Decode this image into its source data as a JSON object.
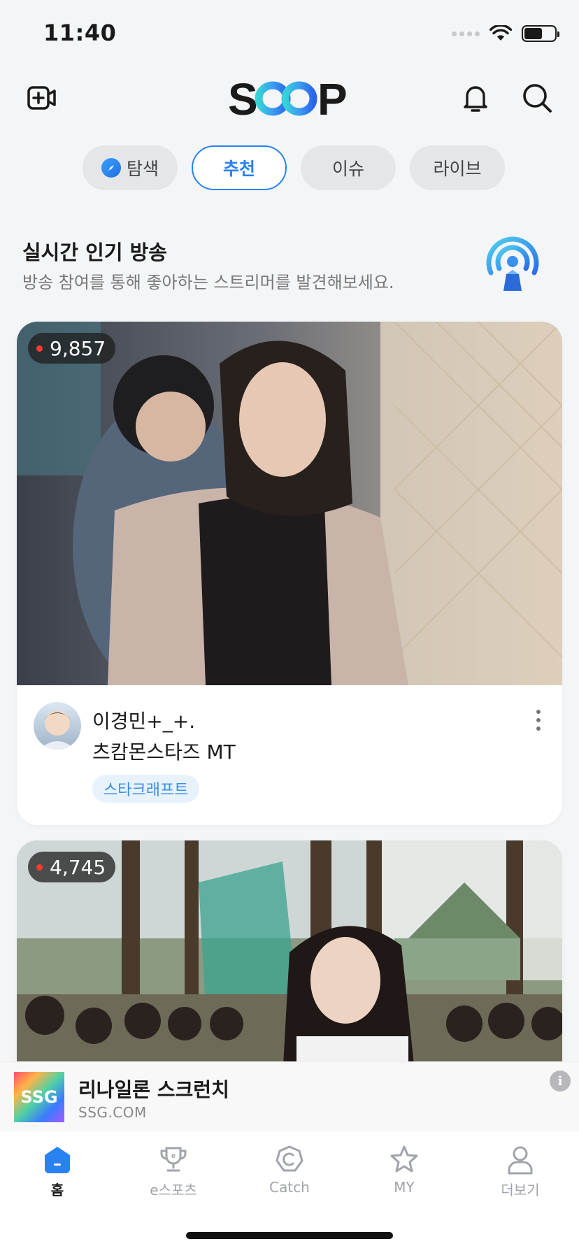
{
  "status_bar": {
    "time": "11:40",
    "battery_level": 0.6
  },
  "header": {
    "create_icon": "video-plus-icon",
    "logo_text": "SOOP",
    "bell_icon": "bell-icon",
    "search_icon": "search-icon"
  },
  "tabs": [
    {
      "label": "탐색",
      "icon": "compass-icon",
      "active": false
    },
    {
      "label": "추천",
      "active": true
    },
    {
      "label": "이슈",
      "active": false
    },
    {
      "label": "라이브",
      "active": false
    }
  ],
  "section": {
    "title": "실시간 인기 방송",
    "subtitle": "방송 참여를 통해 좋아하는 스트리머를 발견해보세요."
  },
  "streams": [
    {
      "viewers": "9,857",
      "streamer": "이경민+_+.",
      "title": "츠캄몬스타즈 MT",
      "category": "스타크래프트"
    },
    {
      "viewers": "4,745"
    }
  ],
  "ad": {
    "logo_text": "SSG",
    "title": "리나일론 스크런치",
    "domain": "SSG.COM"
  },
  "bottom_nav": [
    {
      "label": "홈",
      "icon": "home-icon",
      "active": true
    },
    {
      "label": "e스포츠",
      "icon": "trophy-icon",
      "active": false
    },
    {
      "label": "Catch",
      "icon": "catch-icon",
      "active": false
    },
    {
      "label": "MY",
      "icon": "star-icon",
      "active": false
    },
    {
      "label": "더보기",
      "icon": "person-icon",
      "active": false
    }
  ],
  "colors": {
    "accent": "#2a82f0",
    "live": "#ff3b30"
  }
}
